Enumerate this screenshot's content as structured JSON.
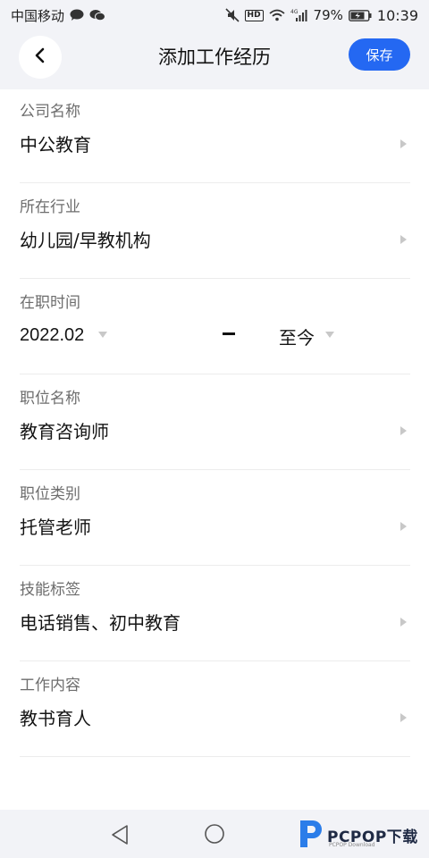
{
  "status_bar": {
    "carrier": "中国移动",
    "battery": "79%",
    "time": "10:39",
    "hd": "HD",
    "network": "4G",
    "icons": [
      "chat-bubble-icon",
      "wechat-icon",
      "mute-icon",
      "hd-icon",
      "wifi-icon",
      "signal-icon",
      "battery-icon"
    ]
  },
  "header": {
    "title": "添加工作经历",
    "save_label": "保存",
    "accent_color": "#2468f2"
  },
  "fields": {
    "company": {
      "label": "公司名称",
      "value": "中公教育"
    },
    "industry": {
      "label": "所在行业",
      "value": "幼儿园/早教机构"
    },
    "tenure": {
      "label": "在职时间",
      "start": "2022.02",
      "end": "至今"
    },
    "position": {
      "label": "职位名称",
      "value": "教育咨询师"
    },
    "category": {
      "label": "职位类别",
      "value": "托管老师"
    },
    "skills": {
      "label": "技能标签",
      "value": "电话销售、初中教育"
    },
    "content": {
      "label": "工作内容",
      "value": "教书育人"
    }
  },
  "watermark": {
    "text": "PCPOP下载",
    "sub": "PCPOP Download"
  }
}
